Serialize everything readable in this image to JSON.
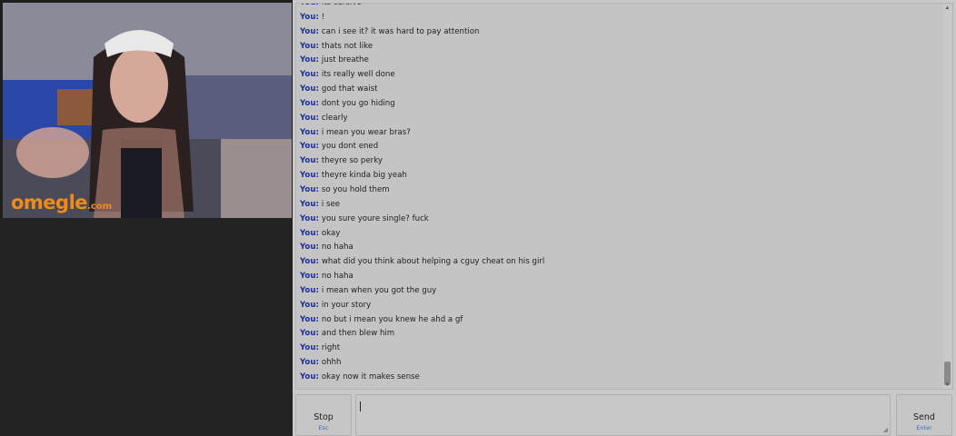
{
  "video": {
    "logo_main": "omegle",
    "logo_suffix": ".com"
  },
  "chat": {
    "messages": [
      {
        "speaker": "You:",
        "text": "its cursive"
      },
      {
        "speaker": "You:",
        "text": "!"
      },
      {
        "speaker": "You:",
        "text": "can i see it? it was hard to pay attention"
      },
      {
        "speaker": "You:",
        "text": "thats not like"
      },
      {
        "speaker": "You:",
        "text": "just breathe"
      },
      {
        "speaker": "You:",
        "text": "its really well done"
      },
      {
        "speaker": "You:",
        "text": "god that waist"
      },
      {
        "speaker": "You:",
        "text": "dont you go hiding"
      },
      {
        "speaker": "You:",
        "text": "clearly"
      },
      {
        "speaker": "You:",
        "text": "i mean you wear bras?"
      },
      {
        "speaker": "You:",
        "text": "you dont ened"
      },
      {
        "speaker": "You:",
        "text": "theyre so perky"
      },
      {
        "speaker": "You:",
        "text": "theyre kinda big yeah"
      },
      {
        "speaker": "You:",
        "text": "so you hold them"
      },
      {
        "speaker": "You:",
        "text": "i see"
      },
      {
        "speaker": "You:",
        "text": "you sure youre single? fuck"
      },
      {
        "speaker": "You:",
        "text": "okay"
      },
      {
        "speaker": "You:",
        "text": "no haha"
      },
      {
        "speaker": "You:",
        "text": "what did you think about helping a cguy cheat on his girl"
      },
      {
        "speaker": "You:",
        "text": "no haha"
      },
      {
        "speaker": "You:",
        "text": "i mean when you got the guy"
      },
      {
        "speaker": "You:",
        "text": "in your story"
      },
      {
        "speaker": "You:",
        "text": "no but i mean you knew he ahd a gf"
      },
      {
        "speaker": "You:",
        "text": "and then blew him"
      },
      {
        "speaker": "You:",
        "text": "right"
      },
      {
        "speaker": "You:",
        "text": "ohhh"
      },
      {
        "speaker": "You:",
        "text": "okay now it makes sense"
      }
    ]
  },
  "controls": {
    "stop_label": "Stop",
    "stop_hint": "Esc",
    "send_label": "Send",
    "send_hint": "Enter",
    "input_value": ""
  },
  "colors": {
    "speaker": "#1f2f9a",
    "hint": "#3a68c4",
    "logo": "#f08a18"
  }
}
